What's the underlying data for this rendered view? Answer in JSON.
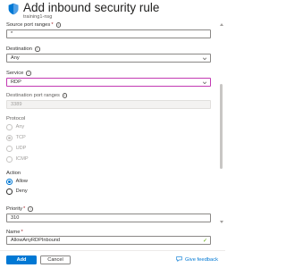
{
  "header": {
    "title": "Add inbound security rule",
    "subtitle": "training1-nsg"
  },
  "form": {
    "source_port_ranges": {
      "label": "Source port ranges",
      "required": "*",
      "value": "*"
    },
    "destination": {
      "label": "Destination",
      "value": "Any"
    },
    "service": {
      "label": "Service",
      "value": "RDP"
    },
    "destination_port_ranges": {
      "label": "Destination port ranges",
      "value": "3389"
    },
    "protocol": {
      "label": "Protocol",
      "options": [
        "Any",
        "TCP",
        "UDP",
        "ICMP"
      ],
      "selected": "TCP"
    },
    "action": {
      "label": "Action",
      "options": [
        "Allow",
        "Deny"
      ],
      "selected": "Allow"
    },
    "priority": {
      "label": "Priority",
      "required": "*",
      "value": "310"
    },
    "name": {
      "label": "Name",
      "required": "*",
      "value": "AllowAnyRDPInbound"
    }
  },
  "footer": {
    "add_label": "Add",
    "cancel_label": "Cancel",
    "feedback_label": "Give feedback"
  },
  "colors": {
    "accent": "#0078d4",
    "focus_border": "#c239b3",
    "valid_check": "#57a300",
    "required": "#a4262c"
  }
}
